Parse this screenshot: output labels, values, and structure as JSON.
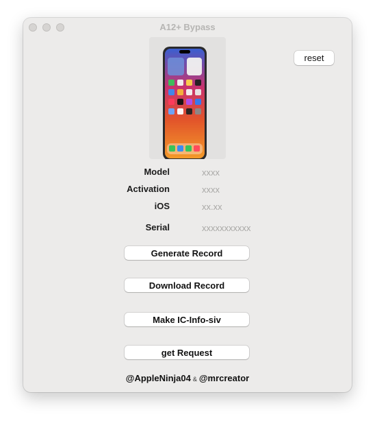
{
  "window": {
    "title": "A12+ Bypass"
  },
  "reset_label": "reset",
  "device": {
    "labels": {
      "model": "Model",
      "activation": "Activation",
      "ios": "iOS",
      "serial": "Serial"
    },
    "values": {
      "model": "xxxx",
      "activation": "xxxx",
      "ios": "xx.xx",
      "serial": "xxxxxxxxxxx"
    }
  },
  "buttons": {
    "generate": "Generate Record",
    "download": "Download Record",
    "make_ic": "Make IC-Info-siv",
    "get_request": "get Request"
  },
  "footer": {
    "user1": "@AppleNinja04",
    "amp": "&",
    "user2": "@mrcreator"
  },
  "icons": {
    "device_image": "iphone-device-icon"
  }
}
